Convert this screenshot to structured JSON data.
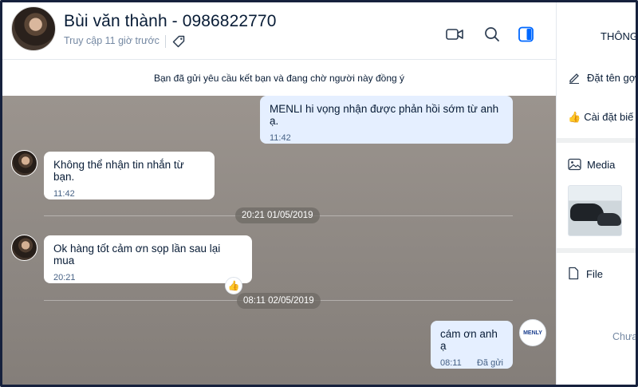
{
  "header": {
    "contact_name": "Bùi văn thành - 0986822770",
    "last_seen": "Truy cập 11 giờ trước"
  },
  "notice": "Bạn đã gửi yêu cầu kết bạn và đang chờ người này đồng ý",
  "messages": {
    "m1": {
      "text": "MENLI hi vọng nhận được phản hồi sớm từ anh ạ.",
      "time": "11:42"
    },
    "m2": {
      "text": "Không thể nhận tin nhắn từ bạn.",
      "time": "11:42"
    },
    "date1": "20:21 01/05/2019",
    "m3": {
      "text": "Ok hàng tốt cảm ơn sọp  lần sau lại mua",
      "time": "20:21"
    },
    "date2": "08:11 02/05/2019",
    "m4": {
      "text": "cám ơn anh ạ",
      "time": "08:11",
      "status": "Đã gửi"
    }
  },
  "menli_logo_text": "MENLY",
  "panel": {
    "title": "THÔNG",
    "rename_label": "Đặt tên gợ",
    "settings_label": "Cài đặt biế",
    "media_label": "Media",
    "file_label": "File",
    "empty_label": "Chưa"
  },
  "colors": {
    "accent": "#0068ff",
    "outgoing_bubble": "#e5efff",
    "incoming_bubble": "#ffffff"
  },
  "icons": [
    "tag-icon",
    "video-call-icon",
    "search-icon",
    "panel-toggle-icon",
    "pencil-icon",
    "thumbs-up-icon",
    "image-icon",
    "file-icon",
    "like-icon"
  ]
}
